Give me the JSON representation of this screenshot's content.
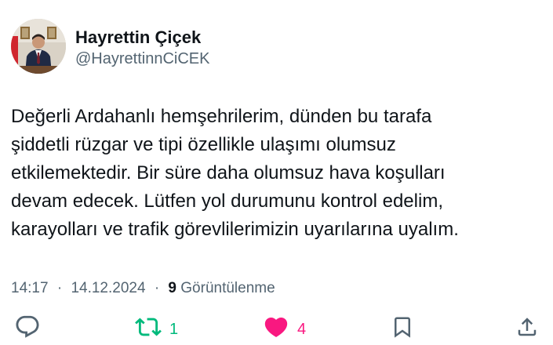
{
  "author": {
    "display_name": "Hayrettin Çiçek",
    "handle": "@HayrettinnCiCEK"
  },
  "tweet": {
    "lines": [
      "Değerli Ardahanlı hemşehrilerim, dünden bu tarafa",
      "şiddetli rüzgar ve tipi özellikle ulaşımı olumsuz",
      "etkilemektedir. Bir süre daha olumsuz hava koşulları",
      "devam edecek. Lütfen yol durumunu kontrol edelim,",
      "karayolları ve trafik görevlilerimizin uyarılarına uyalım."
    ]
  },
  "meta": {
    "time": "14:17",
    "separator": "·",
    "date": "14.12.2024",
    "views_count": "9",
    "views_label": "Görüntülenme"
  },
  "actions": {
    "reply": {
      "icon": "reply-icon",
      "color": "#536471"
    },
    "retweet": {
      "icon": "retweet-icon",
      "count": "1",
      "color": "#00ba7c"
    },
    "like": {
      "icon": "heart-icon",
      "count": "4",
      "color": "#f91880"
    },
    "bookmark": {
      "icon": "bookmark-icon",
      "color": "#536471"
    },
    "share": {
      "icon": "share-icon",
      "color": "#536471"
    }
  },
  "colors": {
    "text_primary": "#0f1419",
    "text_secondary": "#536471"
  }
}
